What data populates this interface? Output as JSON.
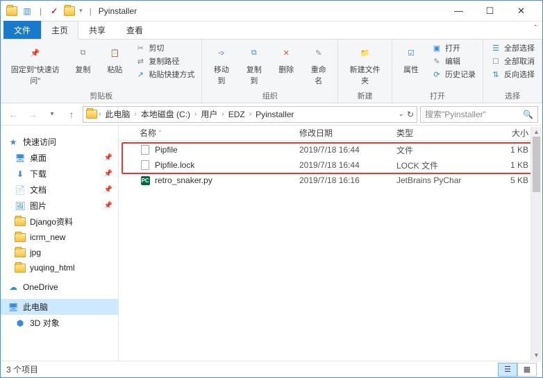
{
  "window": {
    "title": "Pyinstaller"
  },
  "tabs": {
    "file": "文件",
    "home": "主页",
    "share": "共享",
    "view": "查看"
  },
  "ribbon": {
    "clipboard": {
      "label": "剪贴板",
      "pin": "固定到\"快速访问\"",
      "copy": "复制",
      "paste": "粘贴",
      "cut": "剪切",
      "copy_path": "复制路径",
      "paste_shortcut": "粘贴快捷方式"
    },
    "organize": {
      "label": "组织",
      "move_to": "移动到",
      "copy_to": "复制到",
      "delete": "删除",
      "rename": "重命名"
    },
    "new": {
      "label": "新建",
      "new_folder": "新建文件夹"
    },
    "open": {
      "label": "打开",
      "properties": "属性",
      "open": "打开",
      "edit": "编辑",
      "history": "历史记录"
    },
    "select": {
      "label": "选择",
      "select_all": "全部选择",
      "select_none": "全部取消",
      "invert": "反向选择"
    }
  },
  "breadcrumbs": [
    "此电脑",
    "本地磁盘 (C:)",
    "用户",
    "EDZ",
    "Pyinstaller"
  ],
  "search": {
    "placeholder": "搜索\"Pyinstaller\""
  },
  "nav": {
    "quick_access": "快速访问",
    "items_pinned": [
      "桌面",
      "下载",
      "文档",
      "图片"
    ],
    "items_folders": [
      "Django资料",
      "icrm_new",
      "jpg",
      "yuqing_html"
    ],
    "onedrive": "OneDrive",
    "this_pc": "此电脑",
    "this_pc_children": [
      "3D 对象"
    ]
  },
  "columns": {
    "name": "名称",
    "date": "修改日期",
    "type": "类型",
    "size": "大小"
  },
  "files": [
    {
      "name": "Pipfile",
      "date": "2019/7/18 16:44",
      "type": "文件",
      "size": "1 KB",
      "icon": "doc"
    },
    {
      "name": "Pipfile.lock",
      "date": "2019/7/18 16:44",
      "type": "LOCK 文件",
      "size": "1 KB",
      "icon": "doc"
    },
    {
      "name": "retro_snaker.py",
      "date": "2019/7/18 16:16",
      "type": "JetBrains PyChar",
      "size": "5 KB",
      "icon": "pc"
    }
  ],
  "status": {
    "count": "3 个项目"
  }
}
